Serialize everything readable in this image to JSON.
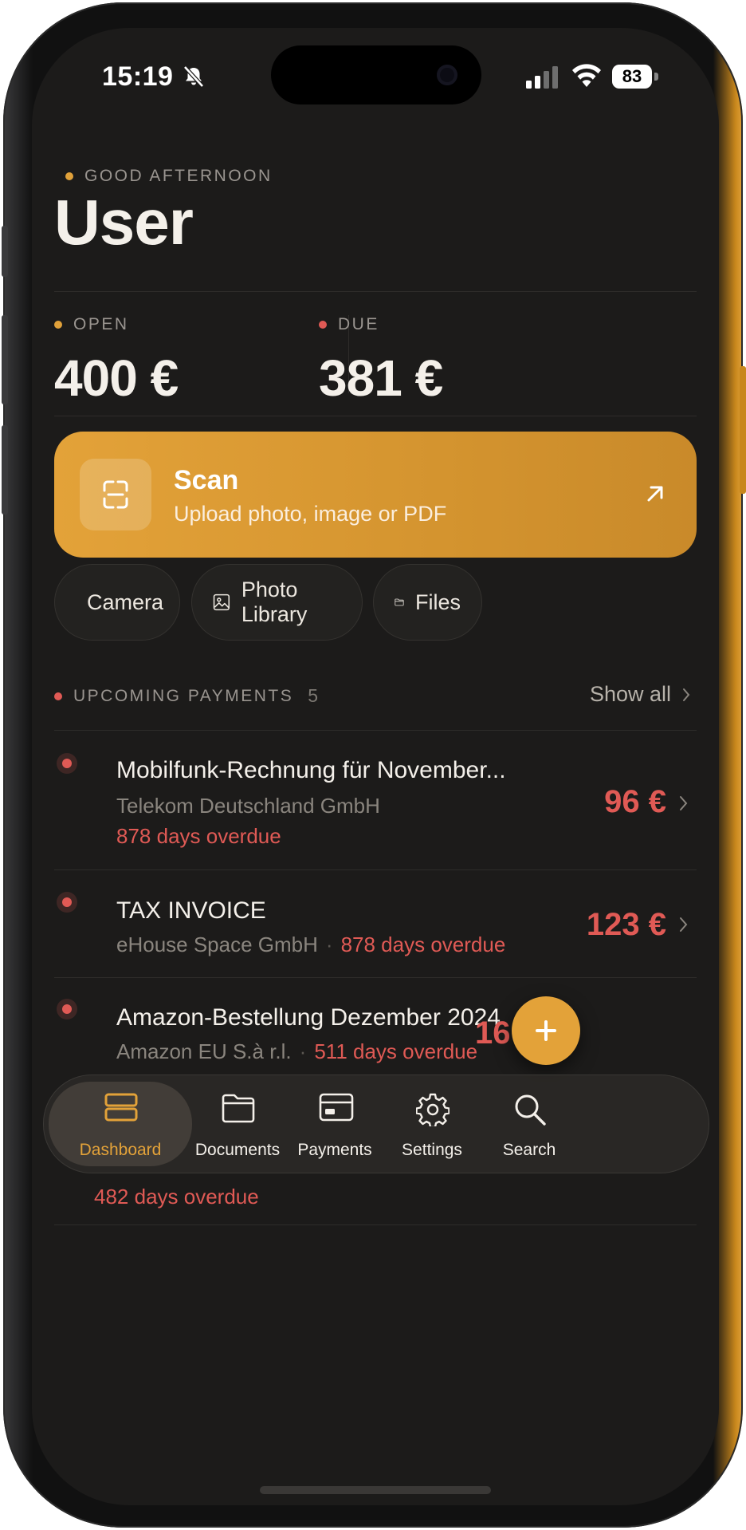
{
  "status_bar": {
    "time": "15:19",
    "battery": "83"
  },
  "greeting": {
    "label": "GOOD AFTERNOON",
    "name": "User"
  },
  "stats": {
    "open": {
      "label": "OPEN",
      "value": "400 €"
    },
    "due": {
      "label": "DUE",
      "value": "381 €"
    }
  },
  "scan": {
    "title": "Scan",
    "subtitle": "Upload photo, image or PDF"
  },
  "quick_actions": [
    {
      "label": "Camera",
      "icon": "camera-icon"
    },
    {
      "label": "Photo Library",
      "icon": "image-icon"
    },
    {
      "label": "Files",
      "icon": "folder-icon"
    }
  ],
  "upcoming": {
    "title": "UPCOMING PAYMENTS",
    "count": "5",
    "show_all": "Show all",
    "items": [
      {
        "title": "Mobilfunk-Rechnung für November...",
        "vendor": "Telekom Deutschland GmbH",
        "overdue": "878 days overdue",
        "amount": "96 €"
      },
      {
        "title": "TAX INVOICE",
        "vendor": "eHouse Space GmbH",
        "overdue": "878 days overdue",
        "amount": "123 €"
      },
      {
        "title": "Amazon-Bestellung Dezember 2024",
        "vendor": "Amazon EU S.à r.l.",
        "overdue": "511 days overdue",
        "amount": "16"
      },
      {
        "overdue": "482 days overdue"
      }
    ]
  },
  "tabs": [
    {
      "label": "Dashboard",
      "icon": "dashboard-icon",
      "active": true
    },
    {
      "label": "Documents",
      "icon": "folder-icon"
    },
    {
      "label": "Payments",
      "icon": "card-icon"
    },
    {
      "label": "Settings",
      "icon": "gear-icon"
    },
    {
      "label": "Search",
      "icon": "search-icon"
    }
  ],
  "colors": {
    "accent": "#e3a239",
    "danger": "#e05a55",
    "background": "#1c1b1a"
  }
}
